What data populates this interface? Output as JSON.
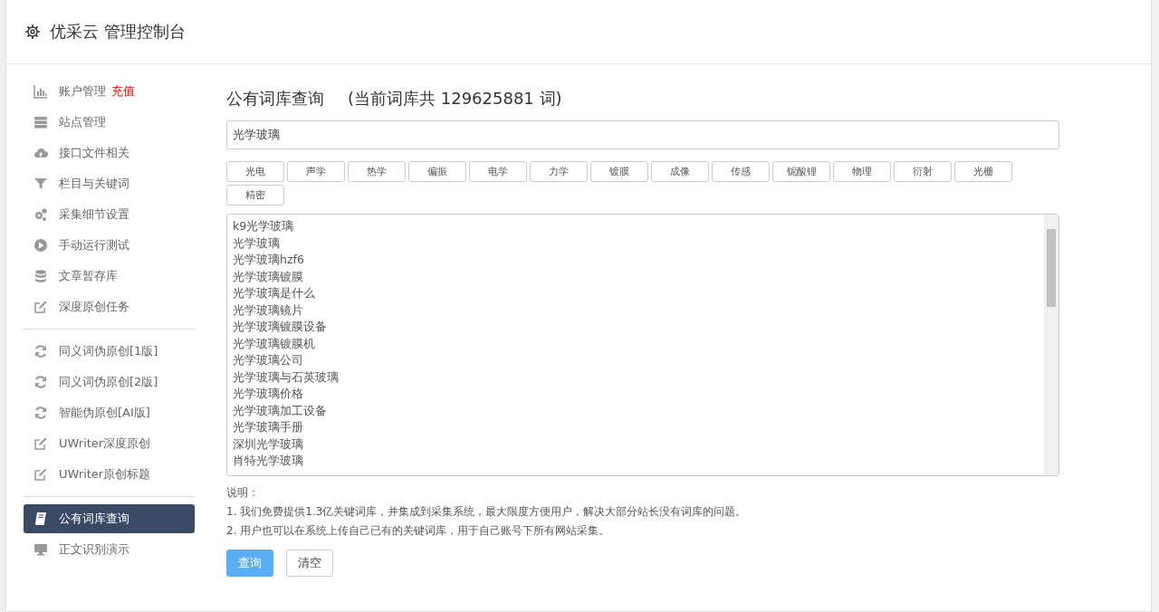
{
  "header": {
    "title": "优采云 管理控制台"
  },
  "sidebar": {
    "groups": [
      [
        {
          "label": "账户管理",
          "badge": "充值",
          "selected": false
        },
        {
          "label": "站点管理",
          "selected": false
        },
        {
          "label": "接口文件相关",
          "selected": false
        },
        {
          "label": "栏目与关键词",
          "selected": false
        },
        {
          "label": "采集细节设置",
          "selected": false
        },
        {
          "label": "手动运行测试",
          "selected": false
        },
        {
          "label": "文章暂存库",
          "selected": false
        },
        {
          "label": "深度原创任务",
          "selected": false
        }
      ],
      [
        {
          "label": "同义词伪原创[1版]",
          "selected": false
        },
        {
          "label": "同义词伪原创[2版]",
          "selected": false
        },
        {
          "label": "智能伪原创[AI版]",
          "selected": false
        },
        {
          "label": "UWriter深度原创",
          "selected": false
        },
        {
          "label": "UWriter原创标题",
          "selected": false
        }
      ],
      [
        {
          "label": "公有词库查询",
          "selected": true
        },
        {
          "label": "正文识别演示",
          "selected": false
        }
      ]
    ]
  },
  "main": {
    "title": "公有词库查询",
    "count_text": "(当前词库共 129625881 词)",
    "search": {
      "value": "光学玻璃"
    },
    "tags": [
      "光电",
      "声学",
      "热学",
      "偏振",
      "电学",
      "力学",
      "镀膜",
      "成像",
      "传感",
      "铌酸锂",
      "物理",
      "衍射",
      "光栅",
      "精密"
    ],
    "keywords": [
      "k9光学玻璃",
      "光学玻璃",
      "光学玻璃hzf6",
      "光学玻璃镀膜",
      "光学玻璃是什么",
      "光学玻璃镜片",
      "光学玻璃镀膜设备",
      "光学玻璃镀膜机",
      "光学玻璃公司",
      "光学玻璃与石英玻璃",
      "光学玻璃价格",
      "光学玻璃加工设备",
      "光学玻璃手册",
      "深圳光学玻璃",
      "肖特光学玻璃"
    ],
    "notes_title": "说明：",
    "notes": [
      "1. 我们免费提供1.3亿关键词库，并集成到采集系统，最大限度方便用户，解决大部分站长没有词库的问题。",
      "2. 用户也可以在系统上传自己已有的关键词库，用于自己账号下所有网站采集。"
    ],
    "buttons": [
      {
        "label": "查询",
        "kind": "primary"
      },
      {
        "label": "清空",
        "kind": "default"
      }
    ]
  }
}
